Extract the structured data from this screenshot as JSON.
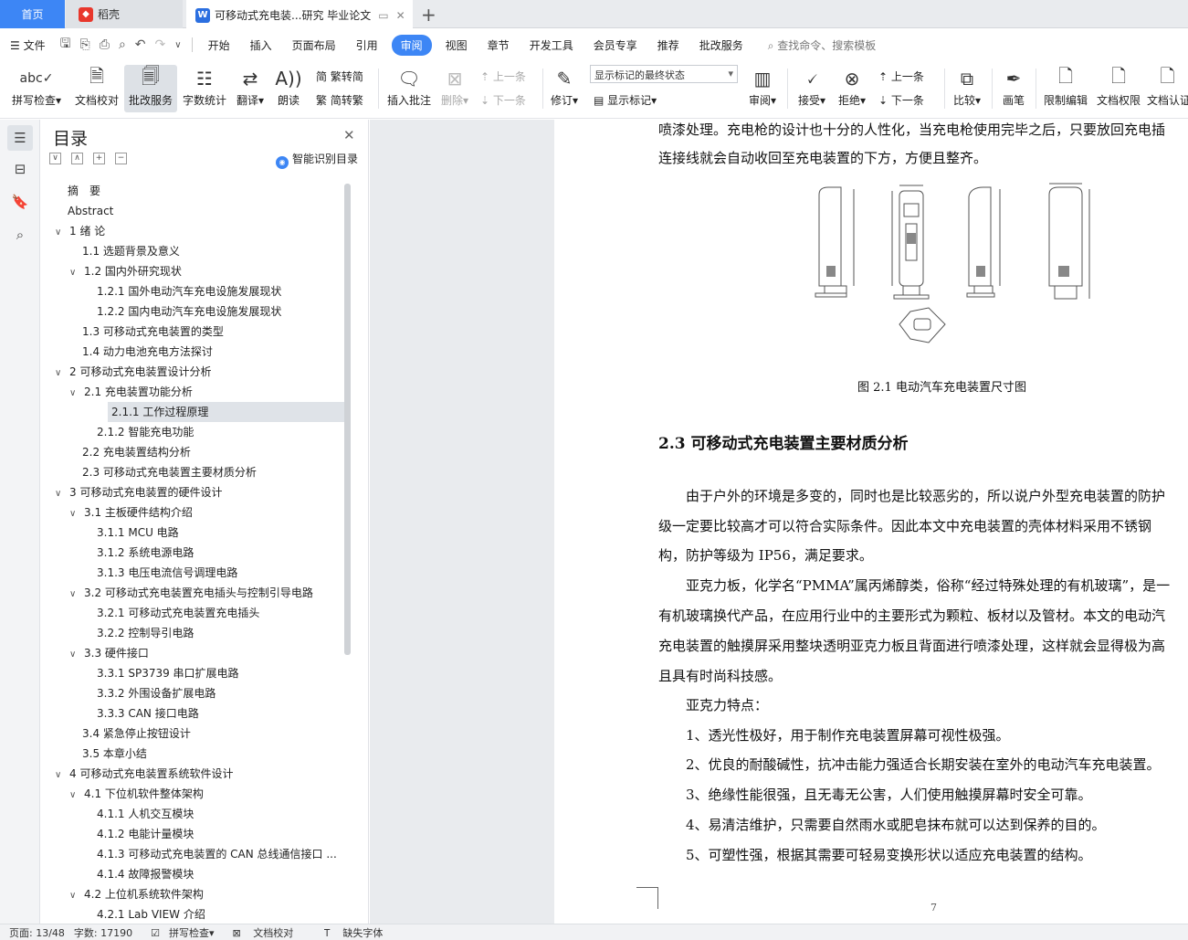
{
  "tabs": {
    "home": "首页",
    "daoke": "稻壳",
    "doc": "可移动式充电装...研究 毕业论文",
    "add": "+"
  },
  "menubar": {
    "file": "文件",
    "items": [
      "开始",
      "插入",
      "页面布局",
      "引用",
      "审阅",
      "视图",
      "章节",
      "开发工具",
      "会员专享",
      "推荐",
      "批改服务"
    ],
    "active": "审阅",
    "search": "查找命令、搜索模板"
  },
  "ribbon": {
    "spell": "拼写检查",
    "proof": "文档校对",
    "correct": "批改服务",
    "wordcount": "字数统计",
    "translate": "翻译",
    "read": "朗读",
    "to_simplified": "繁转简",
    "to_traditional": "简转繁",
    "insert_comment": "插入批注",
    "delete": "删除",
    "prev": "上一条",
    "next": "下一条",
    "revise": "修订",
    "markup_state": "显示标记的最终状态",
    "show_markup": "显示标记",
    "review": "审阅",
    "accept": "接受",
    "reject": "拒绝",
    "prev2": "上一条",
    "next2": "下一条",
    "compare": "比较",
    "pen": "画笔",
    "restrict": "限制编辑",
    "permission": "文档权限",
    "certify": "文档认证"
  },
  "toc": {
    "title": "目录",
    "ai_label": "智能识别目录",
    "items": [
      {
        "label": "摘　要",
        "level": 0,
        "arrow": ""
      },
      {
        "label": "Abstract",
        "level": 0,
        "arrow": ""
      },
      {
        "label": "1  绪  论",
        "level": 0,
        "arrow": "∨"
      },
      {
        "label": "1.1  选题背景及意义",
        "level": 1,
        "arrow": ""
      },
      {
        "label": "1.2  国内外研究现状",
        "level": 1,
        "arrow": "∨"
      },
      {
        "label": "1.2.1  国外电动汽车充电设施发展现状",
        "level": 2,
        "arrow": ""
      },
      {
        "label": "1.2.2  国内电动汽车充电设施发展现状",
        "level": 2,
        "arrow": ""
      },
      {
        "label": "1.3  可移动式充电装置的类型",
        "level": 1,
        "arrow": ""
      },
      {
        "label": "1.4  动力电池充电方法探讨",
        "level": 1,
        "arrow": ""
      },
      {
        "label": "2  可移动式充电装置设计分析",
        "level": 0,
        "arrow": "∨"
      },
      {
        "label": "2.1 充电装置功能分析",
        "level": 1,
        "arrow": "∨"
      },
      {
        "label": "2.1.1  工作过程原理",
        "level": 2,
        "arrow": ""
      },
      {
        "label": "2.1.2  智能充电功能",
        "level": 2,
        "arrow": ""
      },
      {
        "label": "2.2  充电装置结构分析",
        "level": 1,
        "arrow": ""
      },
      {
        "label": "2.3  可移动式充电装置主要材质分析",
        "level": 1,
        "arrow": ""
      },
      {
        "label": "3  可移动式充电装置的硬件设计",
        "level": 0,
        "arrow": "∨"
      },
      {
        "label": "3.1  主板硬件结构介绍",
        "level": 1,
        "arrow": "∨"
      },
      {
        "label": "3.1.1 MCU 电路",
        "level": 2,
        "arrow": ""
      },
      {
        "label": "3.1.2  系统电源电路",
        "level": 2,
        "arrow": ""
      },
      {
        "label": "3.1.3 电压电流信号调理电路",
        "level": 2,
        "arrow": ""
      },
      {
        "label": "3.2  可移动式充电装置充电插头与控制引导电路",
        "level": 1,
        "arrow": "∨"
      },
      {
        "label": "3.2.1  可移动式充电装置充电插头",
        "level": 2,
        "arrow": ""
      },
      {
        "label": "3.2.2  控制导引电路",
        "level": 2,
        "arrow": ""
      },
      {
        "label": "3.3  硬件接口",
        "level": 1,
        "arrow": "∨"
      },
      {
        "label": "3.3.1 SP3739 串口扩展电路",
        "level": 2,
        "arrow": ""
      },
      {
        "label": "3.3.2  外围设备扩展电路",
        "level": 2,
        "arrow": ""
      },
      {
        "label": "3.3.3 CAN  接口电路",
        "level": 2,
        "arrow": ""
      },
      {
        "label": "3.4  紧急停止按钮设计",
        "level": 1,
        "arrow": ""
      },
      {
        "label": "3.5  本章小结",
        "level": 1,
        "arrow": ""
      },
      {
        "label": "4  可移动式充电装置系统软件设计",
        "level": 0,
        "arrow": "∨"
      },
      {
        "label": "4.1 下位机软件整体架构",
        "level": 1,
        "arrow": "∨"
      },
      {
        "label": "4.1.1  人机交互模块",
        "level": 2,
        "arrow": ""
      },
      {
        "label": "4.1.2  电能计量模块",
        "level": 2,
        "arrow": ""
      },
      {
        "label": "4.1.3 可移动式充电装置的 CAN 总线通信接口 ...",
        "level": 2,
        "arrow": ""
      },
      {
        "label": "4.1.4 故障报警模块",
        "level": 2,
        "arrow": ""
      },
      {
        "label": "4.2 上位机系统软件架构",
        "level": 1,
        "arrow": "∨"
      },
      {
        "label": "4.2.1 Lab VIEW 介绍",
        "level": 2,
        "arrow": ""
      }
    ],
    "selected_index": 11
  },
  "document": {
    "lines_top": [
      "喷漆处理。充电枪的设计也十分的人性化，当充电枪使用完毕之后，只要放回充电插",
      "连接线就会自动收回至充电装置的下方，方便且整齐。"
    ],
    "caption": "图 2.1  电动汽车充电装置尺寸图",
    "heading": "2.3  可移动式充电装置主要材质分析",
    "lines_body": [
      "　　由于户外的环境是多变的，同时也是比较恶劣的，所以说户外型充电装置的防护",
      "级一定要比较高才可以符合实际条件。因此本文中充电装置的壳体材料采用不锈钢",
      "构，防护等级为 IP56，满足要求。",
      "　　亚克力板，化学名“PMMA”属丙烯醇类，俗称“经过特殊处理的有机玻璃”，是一",
      "有机玻璃换代产品，在应用行业中的主要形式为颗粒、板材以及管材。本文的电动汽",
      "充电装置的触摸屏采用整块透明亚克力板且背面进行喷漆处理，这样就会显得极为高",
      "且具有时尚科技感。",
      "　　亚克力特点：",
      "　　1、透光性极好，用于制作充电装置屏幕可视性极强。",
      "　　2、优良的耐酸碱性，抗冲击能力强适合长期安装在室外的电动汽车充电装置。",
      "　　3、绝缘性能很强，且无毒无公害，人们使用触摸屏幕时安全可靠。",
      "　　4、易清洁维护，只需要自然雨水或肥皂抹布就可以达到保养的目的。",
      "　　5、可塑性强，根据其需要可轻易变换形状以适应充电装置的结构。"
    ],
    "page_number": "7"
  },
  "status": {
    "page": "页面: 13/48",
    "words": "字数: 17190",
    "spell": "拼写检查",
    "proof": "文档校对",
    "missing_font": "缺失字体"
  }
}
